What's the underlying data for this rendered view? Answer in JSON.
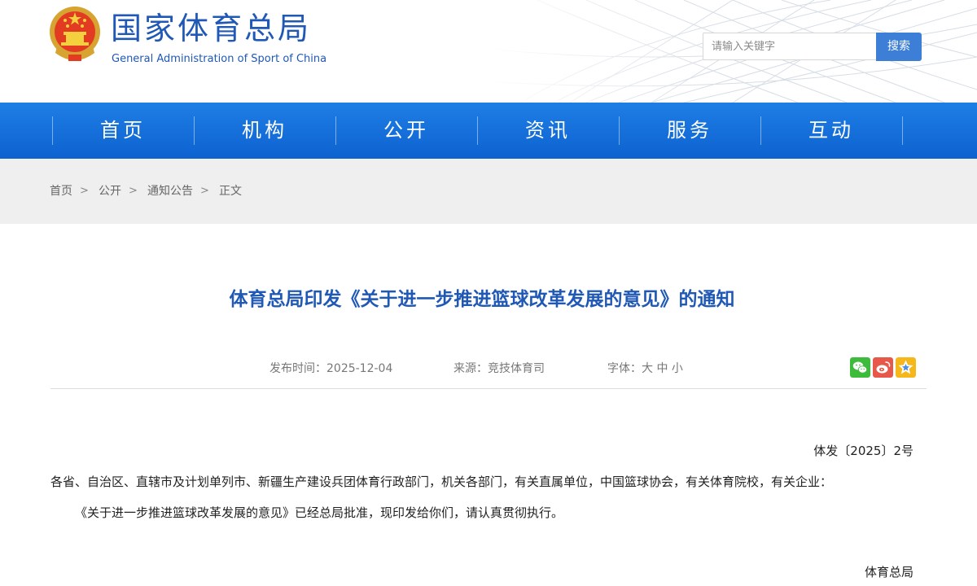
{
  "site": {
    "name_cn": "国家体育总局",
    "name_en": "General Administration of Sport of China"
  },
  "search": {
    "placeholder": "请输入关键字",
    "button_label": "搜索"
  },
  "nav": [
    "首页",
    "机构",
    "公开",
    "资讯",
    "服务",
    "互动"
  ],
  "breadcrumb": {
    "items": [
      "首页",
      "公开",
      "通知公告",
      "正文"
    ],
    "separator": ">"
  },
  "article": {
    "title": "体育总局印发《关于进一步推进篮球改革发展的意见》的通知",
    "meta": {
      "publish_time": "发布时间：2025-12-04",
      "source": "来源：竞技体育司",
      "font_label": "字体：",
      "font_sizes": [
        "大",
        "中",
        "小"
      ]
    },
    "doc_number": "体发〔2025〕2号",
    "recipients": "各省、自治区、直辖市及计划单列市、新疆生产建设兵团体育行政部门，机关各部门，有关直属单位，中国篮球协会，有关体育院校，有关企业：",
    "body_paragraph": "《关于进一步推进篮球改革发展的意见》已经总局批准，现印发给你们，请认真贯彻执行。",
    "signature": "体育总局"
  },
  "share_icons": [
    "wechat-icon",
    "weibo-icon",
    "qzone-icon"
  ],
  "colors": {
    "brand_blue": "#1f58b5",
    "nav_blue": "#1273dd",
    "search_button": "#3d7fd6",
    "breadcrumb_bg": "#efefef",
    "wechat_green": "#3dbb3b",
    "weibo_red": "#e8584a",
    "qzone_yellow": "#f5b71a"
  }
}
